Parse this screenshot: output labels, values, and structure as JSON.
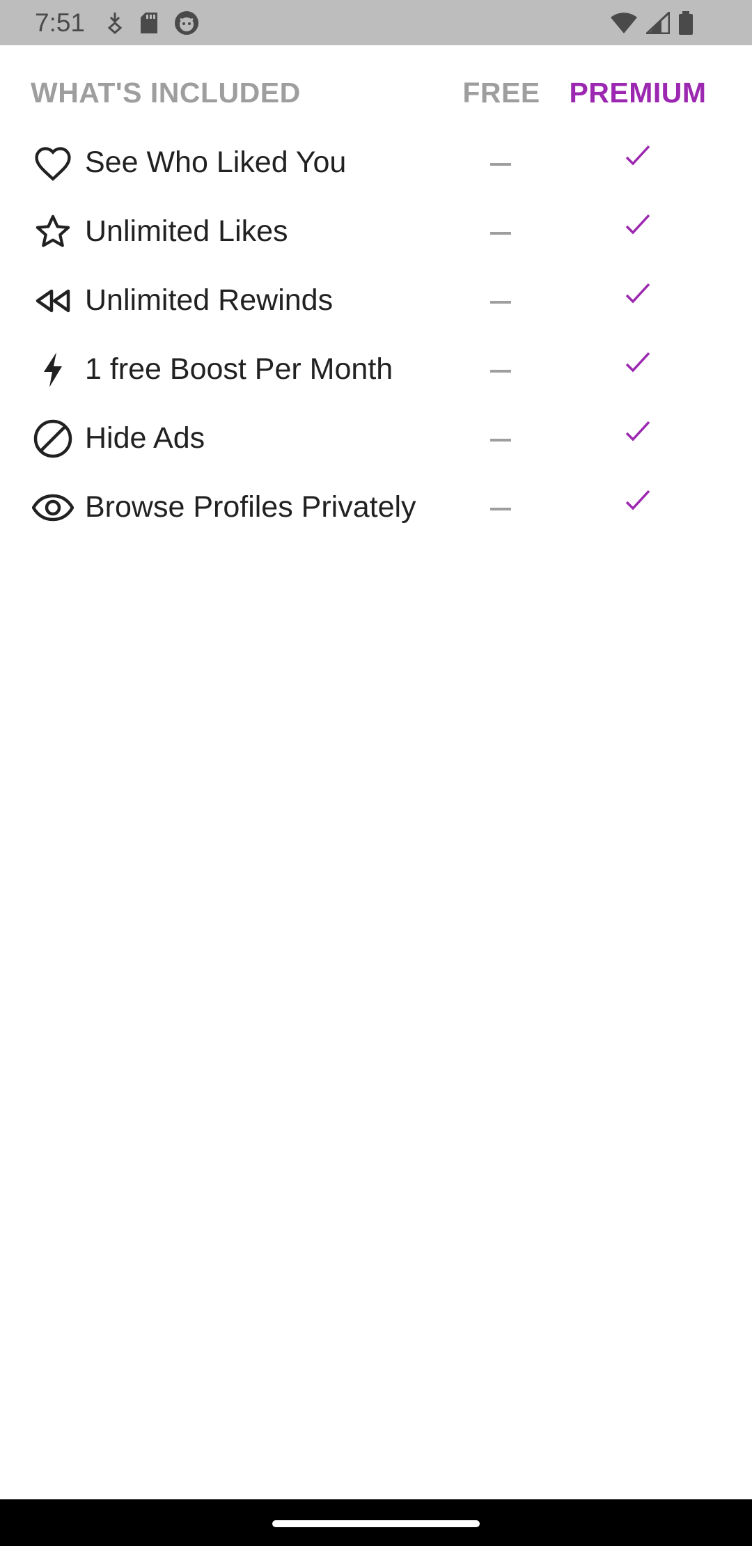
{
  "status_bar": {
    "time": "7:51",
    "left_icons": [
      "download-icon",
      "sd-card-icon",
      "cat-face-icon"
    ],
    "right_icons": [
      "wifi-icon",
      "signal-icon",
      "battery-icon"
    ]
  },
  "header": {
    "title": "WHAT'S INCLUDED",
    "free_label": "FREE",
    "premium_label": "PREMIUM"
  },
  "features": [
    {
      "icon": "heart-icon",
      "label": "See Who Liked You",
      "free": false,
      "premium": true
    },
    {
      "icon": "star-icon",
      "label": "Unlimited Likes",
      "free": false,
      "premium": true
    },
    {
      "icon": "rewind-icon",
      "label": "Unlimited Rewinds",
      "free": false,
      "premium": true
    },
    {
      "icon": "bolt-icon",
      "label": "1 free Boost Per Month",
      "free": false,
      "premium": true
    },
    {
      "icon": "block-icon",
      "label": "Hide Ads",
      "free": false,
      "premium": true
    },
    {
      "icon": "eye-icon",
      "label": "Browse Profiles Privately",
      "free": false,
      "premium": true
    }
  ],
  "colors": {
    "accent": "#9c27b0",
    "muted": "#9e9e9e",
    "text": "#212121"
  }
}
